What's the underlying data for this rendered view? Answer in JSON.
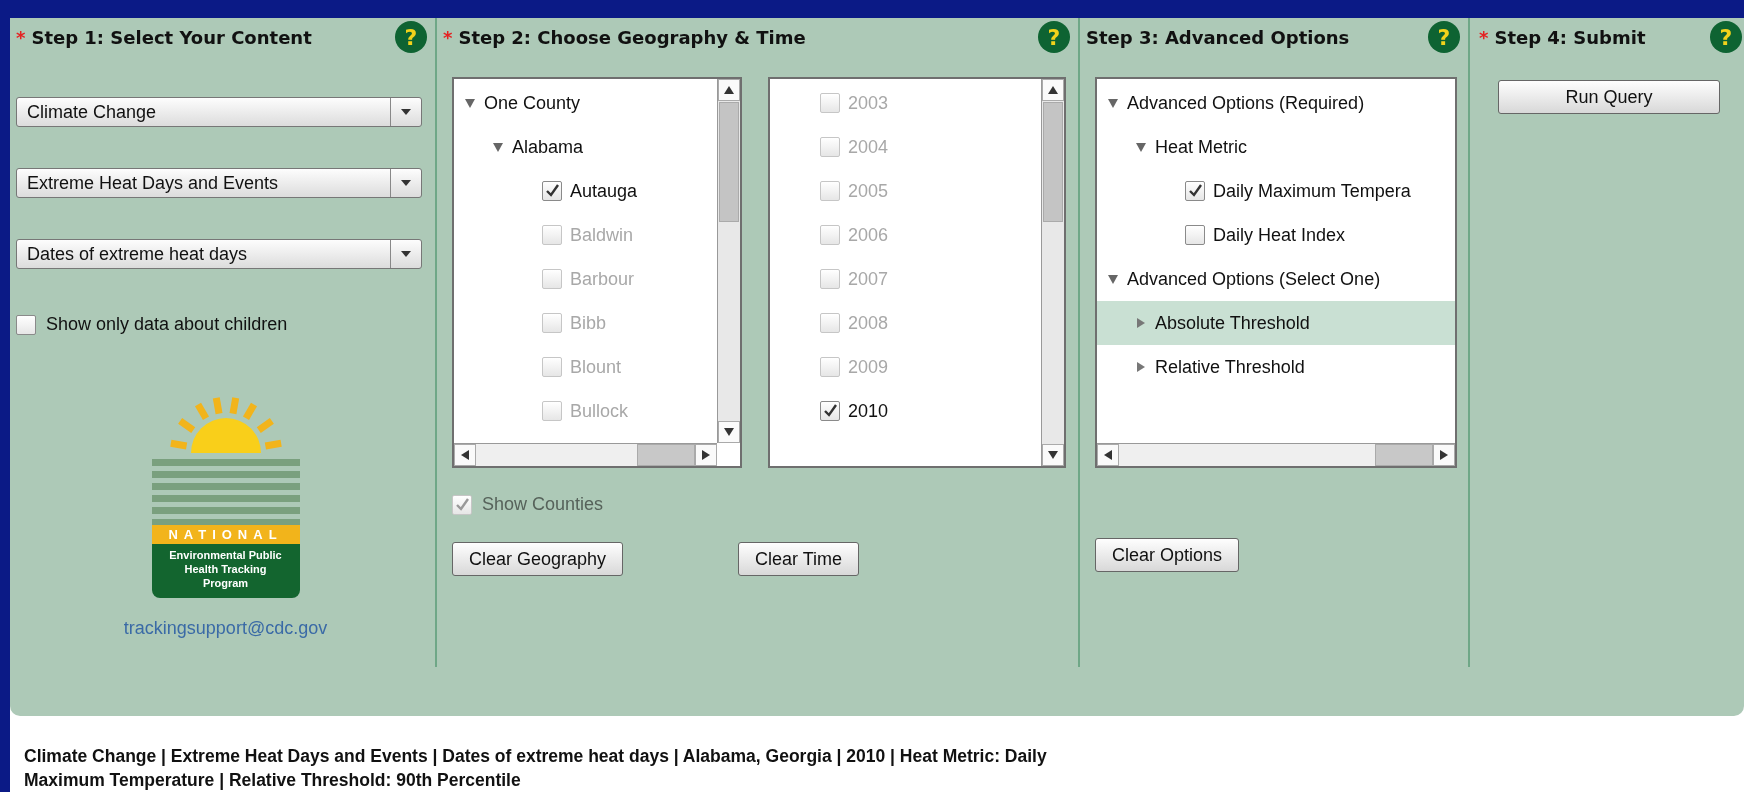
{
  "step1": {
    "title": "Step 1: Select Your Content",
    "required_mark": "*",
    "help": "?",
    "dropdowns": [
      "Climate Change",
      "Extreme Heat Days and Events",
      "Dates of extreme heat days"
    ],
    "children_only": {
      "label": "Show only data about children",
      "checked": false
    },
    "logo": {
      "band": "NATIONAL",
      "caption": [
        "Environmental Public",
        "Health Tracking",
        "Program"
      ]
    },
    "email": "trackingsupport@cdc.gov"
  },
  "step2": {
    "title": "Step 2: Choose Geography & Time",
    "required_mark": "*",
    "help": "?",
    "geography_tree": [
      {
        "label": "One County",
        "kind": "group",
        "expanded": true,
        "children": [
          {
            "label": "Alabama",
            "kind": "group",
            "expanded": true,
            "children": [
              {
                "label": "Autauga",
                "kind": "check",
                "checked": true,
                "disabled": false
              },
              {
                "label": "Baldwin",
                "kind": "check",
                "checked": false,
                "disabled": true
              },
              {
                "label": "Barbour",
                "kind": "check",
                "checked": false,
                "disabled": true
              },
              {
                "label": "Bibb",
                "kind": "check",
                "checked": false,
                "disabled": true
              },
              {
                "label": "Blount",
                "kind": "check",
                "checked": false,
                "disabled": true
              },
              {
                "label": "Bullock",
                "kind": "check",
                "checked": false,
                "disabled": true
              }
            ]
          }
        ]
      }
    ],
    "years": [
      {
        "label": "2003",
        "checked": false,
        "disabled": true
      },
      {
        "label": "2004",
        "checked": false,
        "disabled": true
      },
      {
        "label": "2005",
        "checked": false,
        "disabled": true
      },
      {
        "label": "2006",
        "checked": false,
        "disabled": true
      },
      {
        "label": "2007",
        "checked": false,
        "disabled": true
      },
      {
        "label": "2008",
        "checked": false,
        "disabled": true
      },
      {
        "label": "2009",
        "checked": false,
        "disabled": true
      },
      {
        "label": "2010",
        "checked": true,
        "disabled": false
      }
    ],
    "show_counties": {
      "label": "Show Counties",
      "checked": true,
      "disabled": true
    },
    "buttons": [
      "Clear Geography",
      "Clear Time"
    ]
  },
  "step3": {
    "title": "Step 3: Advanced Options",
    "help": "?",
    "options_tree": [
      {
        "label": "Advanced Options (Required)",
        "kind": "group",
        "expanded": true,
        "selected": false,
        "children": [
          {
            "label": "Heat Metric",
            "kind": "group",
            "expanded": true,
            "selected": false,
            "children": [
              {
                "label": "Daily Maximum Tempera",
                "kind": "check",
                "checked": true,
                "disabled": false,
                "selected": false
              },
              {
                "label": "Daily Heat Index",
                "kind": "check",
                "checked": false,
                "disabled": false,
                "selected": false
              }
            ]
          }
        ]
      },
      {
        "label": "Advanced Options (Select One)",
        "kind": "group",
        "expanded": true,
        "selected": false,
        "children": [
          {
            "label": "Absolute Threshold",
            "kind": "group",
            "expanded": false,
            "selected": true
          },
          {
            "label": "Relative Threshold",
            "kind": "group",
            "expanded": false,
            "selected": false
          }
        ]
      }
    ],
    "button": "Clear Options"
  },
  "step4": {
    "title": "Step 4: Submit",
    "required_mark": "*",
    "help": "?",
    "button": "Run Query"
  },
  "summary": "Climate Change | Extreme Heat Days and Events | Dates of extreme heat days | Alabama, Georgia | 2010 | Heat Metric: Daily Maximum Temperature | Relative Threshold: 90th Percentile"
}
